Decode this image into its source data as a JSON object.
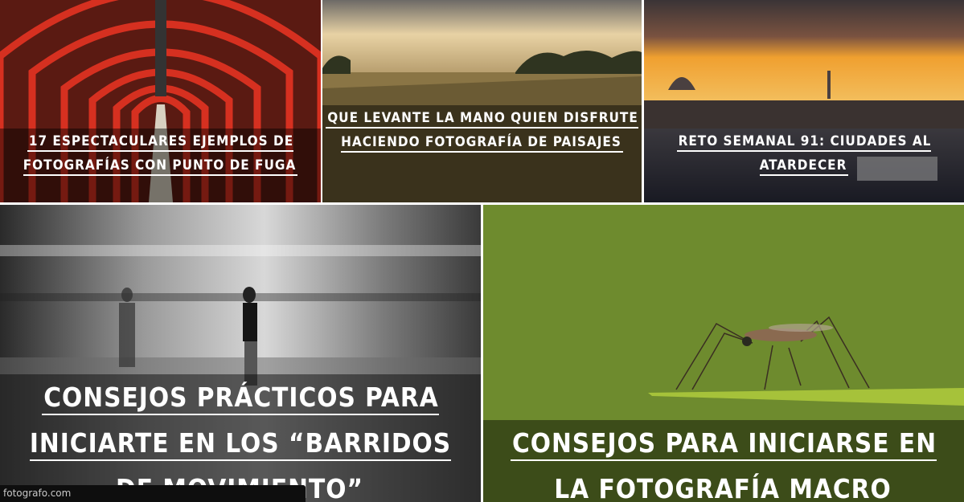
{
  "articles": [
    {
      "title": "17 espectaculares ejemplos de fotografías con punto de fuga"
    },
    {
      "title": "Que levante la mano quien disfrute haciendo fotografía de paisajes"
    },
    {
      "title": "Reto semanal 91: Ciudades al atardecer"
    },
    {
      "title": "Consejos prácticos para iniciarte en los “barridos de movimiento”"
    },
    {
      "title": "Consejos para iniciarse en la fotografía macro"
    }
  ],
  "status_bar": {
    "url": "fotografo.com"
  },
  "colors": {
    "caption_overlay": "rgba(0,0,0,0.45)",
    "macro_green": "#6e8b2e",
    "tunnel_red": "#c8281c"
  }
}
